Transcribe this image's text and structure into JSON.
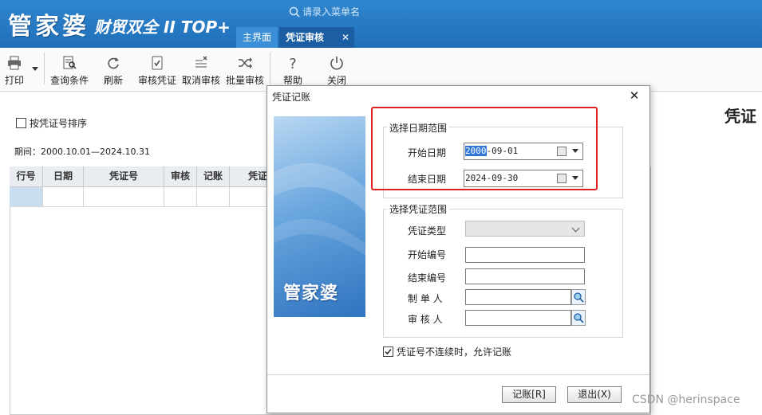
{
  "app": {
    "logo_main": "管家婆",
    "logo_sub": "财贸双全 II TOP+",
    "search_placeholder": "请录入菜单名"
  },
  "tabs": [
    {
      "label": "主界面"
    },
    {
      "label": "凭证审核",
      "close": "✕"
    }
  ],
  "toolbar": {
    "print": "打印",
    "query": "查询条件",
    "refresh": "刷新",
    "audit": "审核凭证",
    "unaudit": "取消审核",
    "batch_audit": "批量审核",
    "help": "帮助",
    "close": "关闭"
  },
  "main": {
    "sort_by_voucher": "按凭证号排序",
    "period": "期间：2000.10.01—2024.10.31",
    "right_title": "凭证",
    "columns": [
      "行号",
      "日期",
      "凭证号",
      "审核",
      "记账",
      "凭证"
    ]
  },
  "dialog": {
    "title": "凭证记账",
    "close": "✕",
    "banner_text": "管家婆",
    "date_range": {
      "legend": "选择日期范围",
      "start_label": "开始日期",
      "start_year": "2000",
      "start_rest": "-09-01",
      "end_label": "结束日期",
      "end_value": "2024-09-30"
    },
    "voucher_range": {
      "legend": "选择凭证范围",
      "type_label": "凭证类型",
      "start_no_label": "开始编号",
      "end_no_label": "结束编号",
      "maker_label": "制 单 人",
      "auditor_label": "审 核 人"
    },
    "allow_noncontinuous": "凭证号不连续时，允许记账",
    "post_button": "记账[R]",
    "exit_button": "退出(X)"
  },
  "watermark": "CSDN @herinspace",
  "colors": {
    "header_blue": "#2f86cf",
    "active_tab": "#1b5ea4",
    "highlight_red": "#e02020",
    "selection_blue": "#3377d8"
  }
}
